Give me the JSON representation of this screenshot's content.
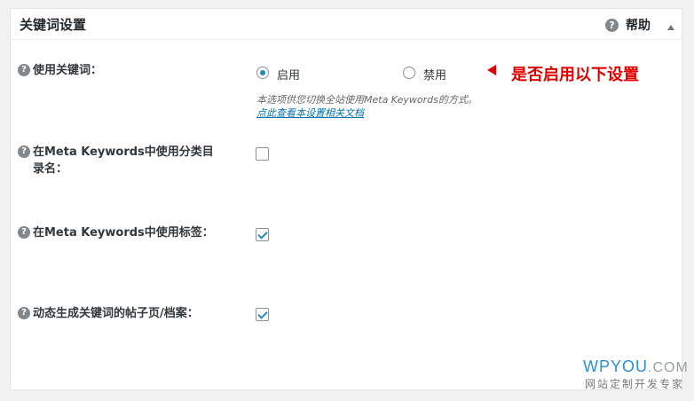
{
  "header": {
    "title": "关键词设置",
    "help_label": "帮助"
  },
  "rows": [
    {
      "label": "使用关键词：",
      "options": [
        {
          "label": "启用",
          "selected": true
        },
        {
          "label": "禁用",
          "selected": false
        }
      ],
      "annotation": "是否启用以下设置",
      "description": "本选项供您切换全站使用Meta Keywords的方式。",
      "doc_link": "点此查看本设置相关文档"
    },
    {
      "label_line1": "在Meta Keywords中使用分类目",
      "label_line2": "录名：",
      "checked": false
    },
    {
      "label": "在Meta Keywords中使用标签：",
      "checked": true
    },
    {
      "label": "动态生成关键词的帖子页/档案：",
      "checked": true
    }
  ],
  "watermark": {
    "brand": "WPYOU",
    "brand_suffix": ".COM",
    "tagline": "网站定制开发专家"
  },
  "colors": {
    "accent": "#1e8cbe",
    "annotation": "#e10000",
    "link": "#0073aa"
  }
}
